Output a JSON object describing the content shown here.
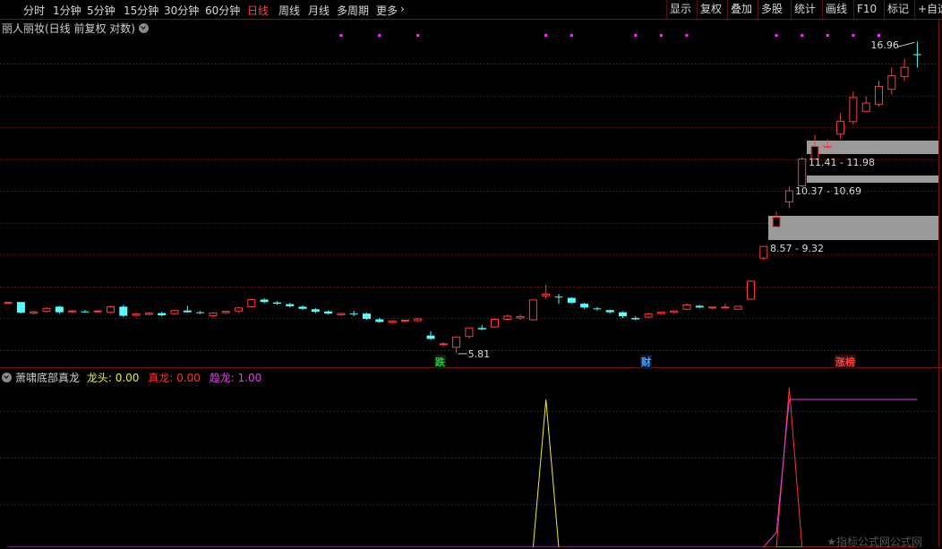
{
  "toolbar": {
    "timeframes": [
      "分时",
      "1分钟",
      "5分钟",
      "15分钟",
      "30分钟",
      "60分钟",
      "日线",
      "周线",
      "月线",
      "多周期",
      "更多"
    ],
    "active_timeframe": "日线",
    "buttons": [
      "显示",
      "复权",
      "叠加",
      "多股",
      "统计",
      "画线",
      "F10",
      "标记",
      "+自选"
    ]
  },
  "main_panel": {
    "title": "丽人丽妆(日线 前复权 对数)",
    "max_label": "16.96",
    "min_label": "5.81",
    "zones": [
      {
        "label": "11.41 - 11.98"
      },
      {
        "label": "10.37 - 10.69"
      },
      {
        "label": "8.57 - 9.32"
      }
    ],
    "signals": [
      {
        "text": "跌",
        "color": "#22cc44"
      },
      {
        "text": "财",
        "color": "#4aa8ff"
      },
      {
        "text": "涨榜",
        "color": "#ff4040"
      }
    ]
  },
  "indicator_panel": {
    "name": "萧啸底部真龙",
    "fields": [
      {
        "label": "龙头",
        "value": "0.00",
        "color": "#f0f020"
      },
      {
        "label": "真龙",
        "value": "0.00",
        "color": "#ff3030"
      },
      {
        "label": "趋龙",
        "value": "1.00",
        "color": "#e040e0"
      }
    ]
  },
  "chart_data": {
    "type": "candlestick",
    "scale": "log",
    "up_color": "#ff3b3b",
    "down_color": "#54ffff",
    "candles": [
      [
        5.95,
        5.98,
        5.92,
        5.96
      ],
      [
        5.97,
        5.97,
        5.7,
        5.72
      ],
      [
        5.71,
        5.76,
        5.68,
        5.74
      ],
      [
        5.75,
        5.85,
        5.72,
        5.82
      ],
      [
        5.86,
        5.88,
        5.7,
        5.73
      ],
      [
        5.74,
        5.78,
        5.71,
        5.76
      ],
      [
        5.75,
        5.78,
        5.72,
        5.74
      ],
      [
        5.75,
        5.78,
        5.72,
        5.76
      ],
      [
        5.73,
        5.88,
        5.7,
        5.86
      ],
      [
        5.86,
        5.9,
        5.62,
        5.65
      ],
      [
        5.66,
        5.72,
        5.63,
        5.69
      ],
      [
        5.68,
        5.73,
        5.66,
        5.71
      ],
      [
        5.71,
        5.74,
        5.64,
        5.66
      ],
      [
        5.7,
        5.79,
        5.68,
        5.77
      ],
      [
        5.77,
        5.88,
        5.72,
        5.73
      ],
      [
        5.73,
        5.76,
        5.69,
        5.71
      ],
      [
        5.65,
        5.73,
        5.61,
        5.71
      ],
      [
        5.72,
        5.77,
        5.7,
        5.75
      ],
      [
        5.76,
        5.86,
        5.72,
        5.83
      ],
      [
        5.86,
        6.05,
        5.84,
        6.03
      ],
      [
        6.03,
        6.06,
        5.94,
        5.97
      ],
      [
        5.96,
        5.99,
        5.9,
        5.93
      ],
      [
        5.92,
        5.95,
        5.84,
        5.87
      ],
      [
        5.86,
        5.89,
        5.78,
        5.81
      ],
      [
        5.8,
        5.83,
        5.71,
        5.74
      ],
      [
        5.75,
        5.77,
        5.68,
        5.7
      ],
      [
        5.67,
        5.72,
        5.65,
        5.7
      ],
      [
        5.7,
        5.76,
        5.64,
        5.69
      ],
      [
        5.7,
        5.72,
        5.56,
        5.58
      ],
      [
        5.57,
        5.6,
        5.49,
        5.51
      ],
      [
        5.5,
        5.54,
        5.48,
        5.53
      ],
      [
        5.53,
        5.56,
        5.51,
        5.55
      ],
      [
        5.54,
        5.6,
        5.52,
        5.58
      ],
      [
        5.22,
        5.31,
        5.13,
        5.15
      ],
      [
        5.05,
        5.08,
        5.01,
        5.05
      ],
      [
        4.98,
        5.19,
        4.87,
        5.19
      ],
      [
        5.2,
        5.39,
        5.16,
        5.38
      ],
      [
        5.38,
        5.44,
        5.33,
        5.35
      ],
      [
        5.4,
        5.58,
        5.39,
        5.57
      ],
      [
        5.57,
        5.68,
        5.54,
        5.64
      ],
      [
        5.6,
        5.68,
        5.56,
        5.63
      ],
      [
        5.56,
        6.03,
        5.54,
        6.02
      ],
      [
        6.12,
        6.4,
        6.05,
        6.16
      ],
      [
        6.1,
        6.16,
        5.93,
        6.09
      ],
      [
        6.07,
        6.09,
        5.93,
        5.95
      ],
      [
        5.93,
        5.95,
        5.81,
        5.84
      ],
      [
        5.82,
        5.85,
        5.77,
        5.8
      ],
      [
        5.78,
        5.79,
        5.7,
        5.73
      ],
      [
        5.73,
        5.75,
        5.6,
        5.64
      ],
      [
        5.6,
        5.64,
        5.55,
        5.57
      ],
      [
        5.62,
        5.71,
        5.6,
        5.69
      ],
      [
        5.7,
        5.74,
        5.68,
        5.73
      ],
      [
        5.73,
        5.77,
        5.7,
        5.76
      ],
      [
        5.8,
        5.93,
        5.78,
        5.9
      ],
      [
        5.88,
        5.9,
        5.82,
        5.84
      ],
      [
        5.84,
        5.86,
        5.8,
        5.85
      ],
      [
        5.85,
        5.93,
        5.83,
        5.85
      ],
      [
        5.8,
        5.88,
        5.79,
        5.87
      ],
      [
        6.04,
        6.51,
        6.03,
        6.49
      ],
      [
        7.12,
        7.46,
        7.06,
        7.46
      ],
      [
        8.07,
        8.58,
        8.06,
        8.39
      ],
      [
        8.92,
        9.49,
        8.69,
        9.32
      ],
      [
        9.51,
        10.67,
        9.45,
        10.59
      ],
      [
        10.6,
        11.67,
        10.59,
        11.14
      ],
      [
        11.13,
        11.45,
        11.05,
        11.14
      ],
      [
        11.7,
        12.73,
        11.49,
        12.32
      ],
      [
        12.3,
        13.88,
        12.16,
        13.55
      ],
      [
        12.82,
        13.61,
        12.82,
        13.25
      ],
      [
        13.19,
        14.49,
        13.07,
        14.16
      ],
      [
        14.0,
        15.28,
        13.72,
        14.78
      ],
      [
        14.74,
        15.83,
        14.48,
        15.29
      ],
      [
        16.12,
        16.96,
        15.28,
        16.06
      ]
    ],
    "indicator_series": [
      {
        "name": "龙头",
        "color": "#f0f020",
        "values": [
          0,
          0,
          0,
          0,
          0,
          0,
          0,
          0,
          0,
          0,
          0,
          0,
          0,
          0,
          0,
          0,
          0,
          0,
          0,
          0,
          0,
          0,
          0,
          0,
          0,
          0,
          0,
          0,
          0,
          0,
          0,
          0,
          0,
          0,
          0,
          0,
          0,
          0,
          0,
          0,
          0,
          0,
          1,
          0,
          0,
          0,
          0,
          0,
          0,
          0,
          0,
          0,
          0,
          0,
          0,
          0,
          0,
          0,
          0,
          0,
          0,
          0,
          0,
          0,
          0,
          0,
          0,
          0,
          0,
          0,
          0,
          0
        ]
      },
      {
        "name": "真龙",
        "color": "#ff3030",
        "values": [
          0,
          0,
          0,
          0,
          0,
          0,
          0,
          0,
          0,
          0,
          0,
          0,
          0,
          0,
          0,
          0,
          0,
          0,
          0,
          0,
          0,
          0,
          0,
          0,
          0,
          0,
          0,
          0,
          0,
          0,
          0,
          0,
          0,
          0,
          0,
          0,
          0,
          0,
          0,
          0,
          0,
          0,
          0,
          0,
          0,
          0,
          0,
          0,
          0,
          0,
          0,
          0,
          0,
          0,
          0,
          0,
          0,
          0,
          0,
          0,
          0,
          1.08,
          0,
          0,
          0,
          0,
          0,
          0,
          0,
          0,
          0,
          0
        ]
      },
      {
        "name": "趋龙",
        "color": "#e040e0",
        "values": [
          0,
          0,
          0,
          0,
          0,
          0,
          0,
          0,
          0,
          0,
          0,
          0,
          0,
          0,
          0,
          0,
          0,
          0,
          0,
          0,
          0,
          0,
          0,
          0,
          0,
          0,
          0,
          0,
          0,
          0,
          0,
          0,
          0,
          0,
          0,
          0,
          0,
          0,
          0,
          0,
          0,
          0,
          0,
          0,
          0,
          0,
          0,
          0,
          0,
          0,
          0,
          0,
          0,
          0,
          0,
          0,
          0,
          0,
          0,
          0,
          0.1,
          1,
          1,
          1,
          1,
          1,
          1,
          1,
          1,
          1,
          1,
          1
        ]
      }
    ],
    "magenta_dots": [
      26,
      29,
      32,
      42,
      44,
      49,
      51,
      53,
      60,
      62,
      64,
      66,
      68
    ]
  }
}
